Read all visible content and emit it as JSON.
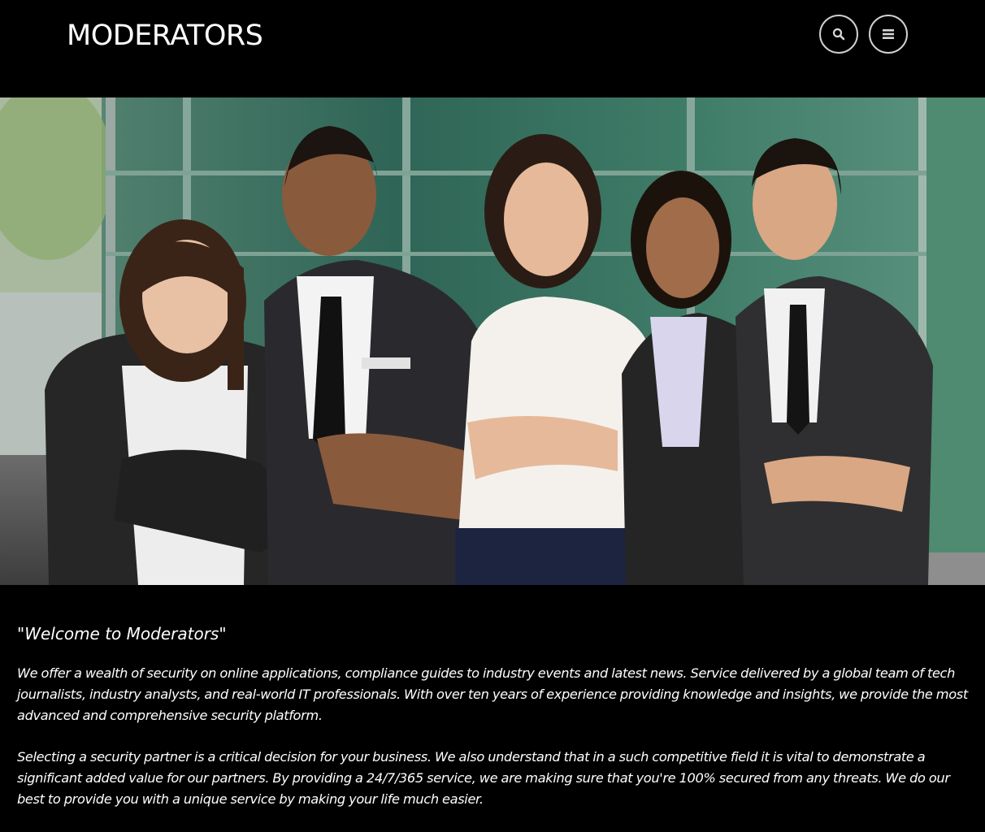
{
  "header": {
    "site_title": "MODERATORS",
    "search_button_icon": "search-icon",
    "menu_button_icon": "hamburger-menu-icon"
  },
  "hero": {
    "image_subject": "team-photo"
  },
  "content": {
    "welcome_heading": "\"Welcome to Moderators\"",
    "paragraphs": [
      "We offer a wealth of security on online applications, compliance guides to industry events and latest news. Service delivered by a global team of tech journalists, industry analysts, and real-world IT professionals. With over ten years of experience providing knowledge and insights, we provide the most advanced and comprehensive security platform.",
      "Selecting a security partner is a critical decision for your business. We also understand that in a such competitive field it is vital to demonstrate a significant added value for our partners. By providing a 24/7/365 service, we are making sure that you're 100% secured from any threats. We do our best to provide you with a unique service by making your life much easier."
    ]
  },
  "colors": {
    "background": "#000000",
    "text": "#ffffff",
    "button_border": "#cfcfcf"
  }
}
